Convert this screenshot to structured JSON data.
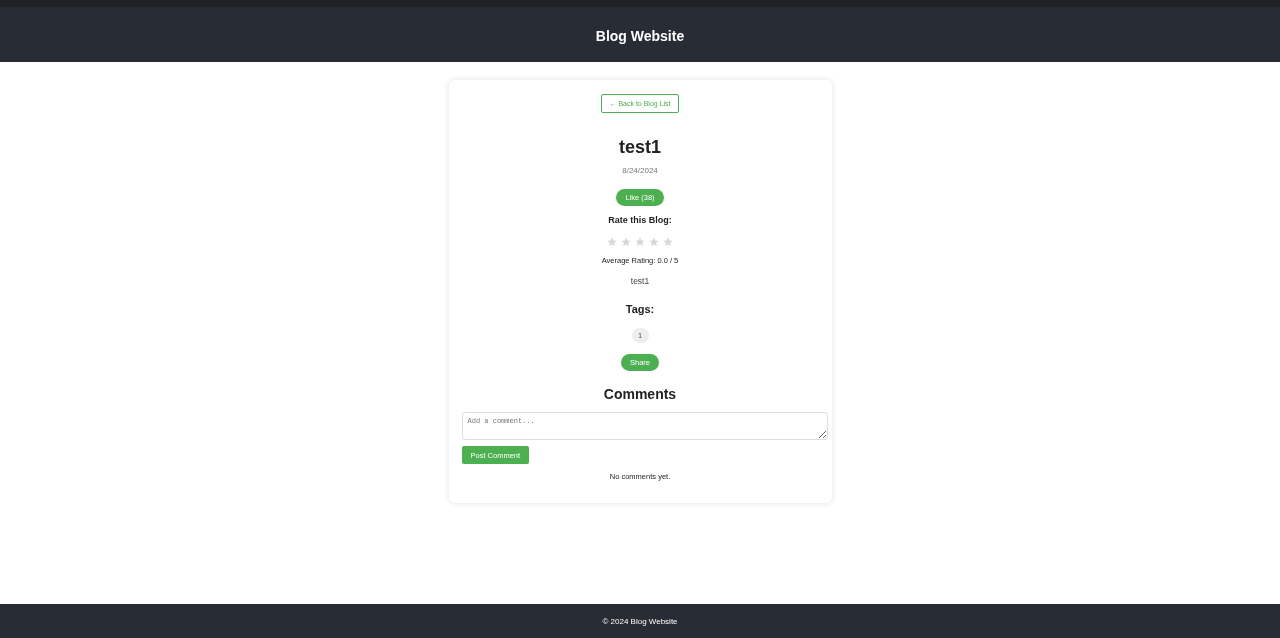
{
  "header": {
    "title": "Blog Website"
  },
  "post": {
    "back_link": "← Back to Blog List",
    "title": "test1",
    "date": "8/24/2024",
    "like_button": "Like (38)",
    "rating": {
      "label": "Rate this Blog:",
      "stars": 0,
      "average": "Average Rating: 0.0 / 5"
    },
    "content": "test1",
    "tags_heading": "Tags:",
    "tags": [
      "1"
    ],
    "share_button": "Share"
  },
  "comments": {
    "heading": "Comments",
    "placeholder": "Add a comment...",
    "post_button": "Post Comment",
    "empty_text": "No comments yet."
  },
  "footer": {
    "text": "© 2024 Blog Website"
  }
}
